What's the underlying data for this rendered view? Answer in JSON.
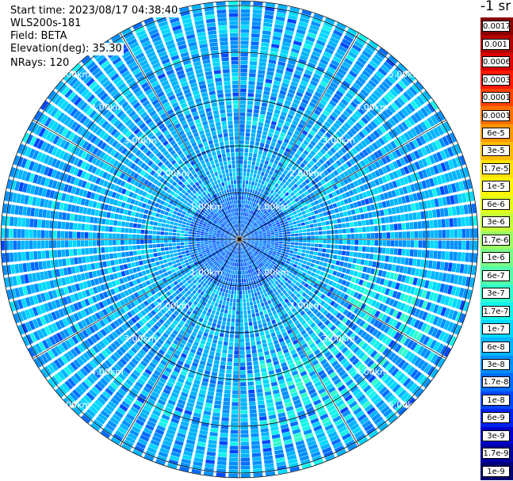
{
  "header": {
    "start_time": "Start time: 2023/08/17 04:38:40",
    "instrument": "WLS200s-181",
    "field": "Field: BETA",
    "elevation": "Elevation(deg): 35.30",
    "nrays": "NRays: 120"
  },
  "colorbar": {
    "unit": "-1 sr",
    "labels": [
      "0.0017",
      "0.001",
      "0.0006",
      "0.0003",
      "0.00017",
      "0.0001",
      "6e-5",
      "3e-5",
      "1.7e-5",
      "1e-5",
      "6e-6",
      "3e-6",
      "1.7e-6",
      "1e-6",
      "6e-7",
      "3e-7",
      "1.7e-7",
      "1e-7",
      "6e-8",
      "3e-8",
      "1.7e-8",
      "1e-8",
      "6e-9",
      "3e-9",
      "1.7e-9",
      "1e-9"
    ],
    "colors": [
      "#880000",
      "#b00000",
      "#dd0000",
      "#ff1800",
      "#ff4400",
      "#ff7000",
      "#ff9800",
      "#ffbe00",
      "#ffe000",
      "#fff600",
      "#e4ff18",
      "#c4ff3a",
      "#9cff62",
      "#78ff86",
      "#54ffaa",
      "#32ffcc",
      "#14f4ec",
      "#00d8ff",
      "#00b4ff",
      "#0090ff",
      "#006cff",
      "#0046ff",
      "#0022ee",
      "#0000cc",
      "#00009e",
      "#000070"
    ]
  },
  "chart_data": {
    "type": "heatmap",
    "projection": "polar PPI",
    "field": "BETA",
    "nrays": 120,
    "range_rings_km": [
      1,
      2,
      3,
      4,
      5
    ],
    "range_ring_labels": [
      "1.00km",
      "2.00km",
      "3.00km",
      "4.00km",
      "5.00km"
    ],
    "radial_lines_deg": [
      0,
      30,
      60,
      90,
      120,
      150,
      180,
      210,
      240,
      270,
      300,
      330
    ],
    "max_range_km": 5.1,
    "colorscale": "jet (log)"
  }
}
